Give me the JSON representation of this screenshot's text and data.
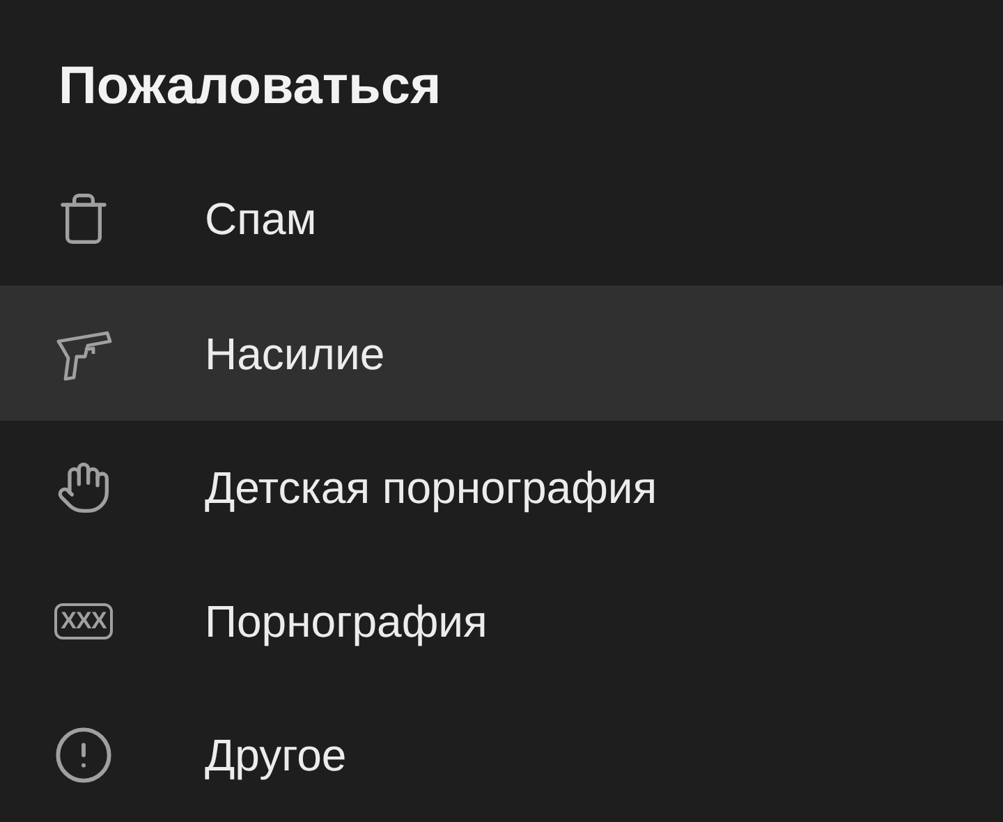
{
  "title": "Пожаловаться",
  "items": [
    {
      "kind": "trash",
      "label": "Спам",
      "selected": false
    },
    {
      "kind": "gun",
      "label": "Насилие",
      "selected": true
    },
    {
      "kind": "hand",
      "label": "Детская порнография",
      "selected": false
    },
    {
      "kind": "xxx",
      "icon_text": "XXX",
      "label": "Порнография",
      "selected": false
    },
    {
      "kind": "alert",
      "label": "Другое",
      "selected": false
    }
  ]
}
